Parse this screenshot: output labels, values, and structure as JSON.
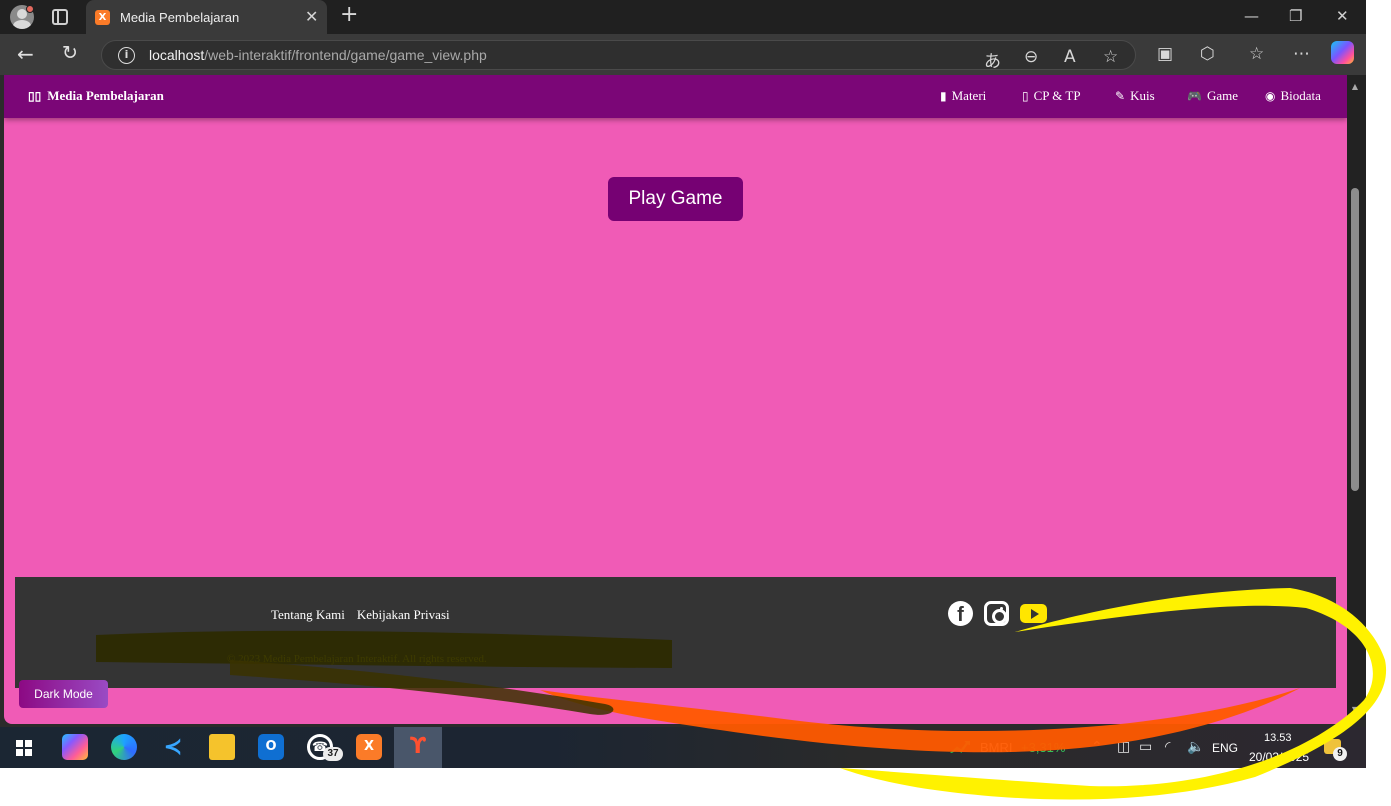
{
  "browser": {
    "tab_title": "Media Pembelajaran",
    "tab_favicon": "xampp-icon",
    "url_host": "localhost",
    "url_path": "/web-interaktif/frontend/game/game_view.php",
    "toolbar_icons": [
      "translate-icon",
      "zoom-out-icon",
      "read-aloud-icon",
      "favorite-star-icon",
      "collections-icon",
      "extensions-icon",
      "favorites-icon",
      "more-icon",
      "copilot-icon"
    ]
  },
  "page": {
    "brand": "Media Pembelajaran",
    "nav": [
      {
        "label": "Materi",
        "icon": "book-icon"
      },
      {
        "label": "CP & TP",
        "icon": "clipboard-icon"
      },
      {
        "label": "Kuis",
        "icon": "edit-icon"
      },
      {
        "label": "Game",
        "icon": "gamepad-icon"
      },
      {
        "label": "Biodata",
        "icon": "user-circle-icon"
      }
    ],
    "play_button": "Play Game",
    "footer": {
      "links": [
        "Tentang Kami",
        "Kebijakan Privasi"
      ],
      "copyright": "© 2023 Media Pembelajaran Interaktif. All rights reserved.",
      "social_icons": [
        "facebook-icon",
        "instagram-icon",
        "youtube-icon"
      ]
    },
    "dark_mode_button": "Dark Mode"
  },
  "taskbar": {
    "stock_name": "BMRI",
    "stock_change": "+3,31%",
    "language": "ENG",
    "time": "13.53",
    "date": "20/03/2025",
    "notification_count": "9",
    "whatsapp_badge": "37",
    "apps": [
      "copilot-icon",
      "edge-icon",
      "vscode-icon",
      "file-explorer-icon",
      "outlook-icon",
      "whatsapp-icon",
      "xampp-icon",
      "app-icon"
    ]
  },
  "colors": {
    "page_background": "#f05bb6",
    "navbar": "#7b0677",
    "footer": "#343434",
    "copyright_text": "#f2e800",
    "annotation_yellow": "#fff000",
    "annotation_orange": "#ff5a00"
  }
}
